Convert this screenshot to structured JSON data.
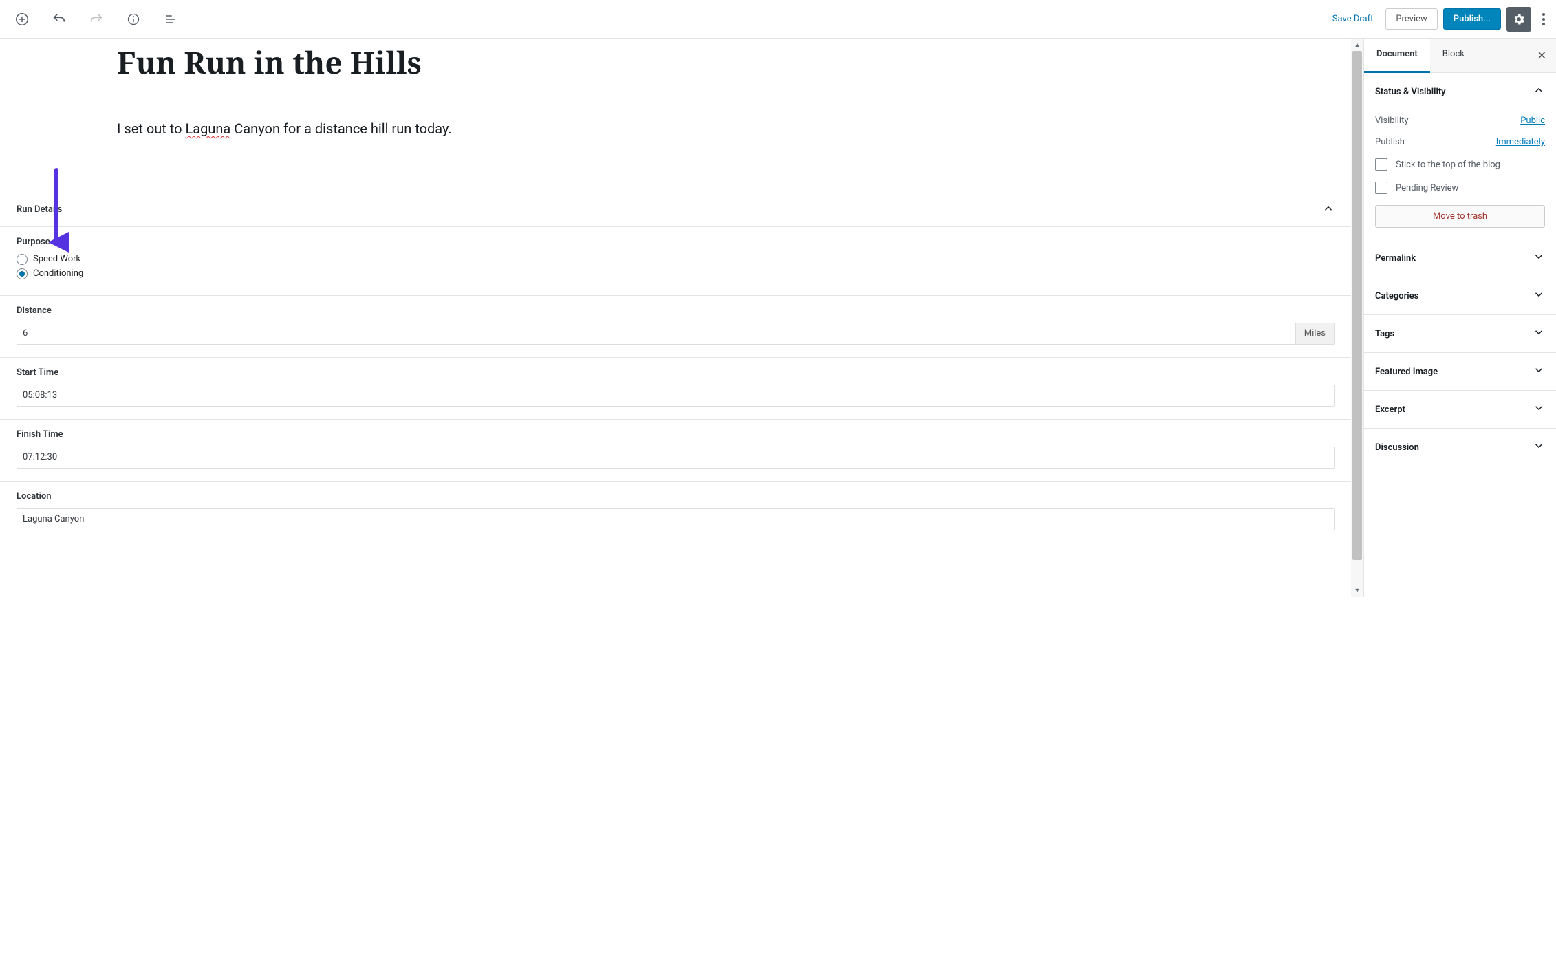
{
  "toolbar": {
    "save_draft": "Save Draft",
    "preview": "Preview",
    "publish": "Publish..."
  },
  "post": {
    "title": "Fun Run in the Hills",
    "body_prefix": "I set out to ",
    "body_spellerr": "Laguna",
    "body_suffix": " Canyon for a distance hill run today."
  },
  "metabox": {
    "title": "Run Details",
    "fields": {
      "purpose_label": "Purpose",
      "purpose_options": {
        "speed": "Speed Work",
        "conditioning": "Conditioning"
      },
      "purpose_selected": "conditioning",
      "distance_label": "Distance",
      "distance_value": "6",
      "distance_unit": "Miles",
      "start_label": "Start Time",
      "start_value": "05:08:13",
      "finish_label": "Finish Time",
      "finish_value": "07:12:30",
      "location_label": "Location",
      "location_value": "Laguna Canyon"
    }
  },
  "sidebar": {
    "tabs": {
      "document": "Document",
      "block": "Block"
    },
    "status_panel": {
      "title": "Status & Visibility",
      "visibility_label": "Visibility",
      "visibility_value": "Public",
      "publish_label": "Publish",
      "publish_value": "Immediately",
      "sticky": "Stick to the top of the blog",
      "pending": "Pending Review",
      "trash": "Move to trash"
    },
    "panels": {
      "permalink": "Permalink",
      "categories": "Categories",
      "tags": "Tags",
      "featured_image": "Featured Image",
      "excerpt": "Excerpt",
      "discussion": "Discussion"
    }
  },
  "annotation": {
    "arrow_color": "#5533e0"
  }
}
